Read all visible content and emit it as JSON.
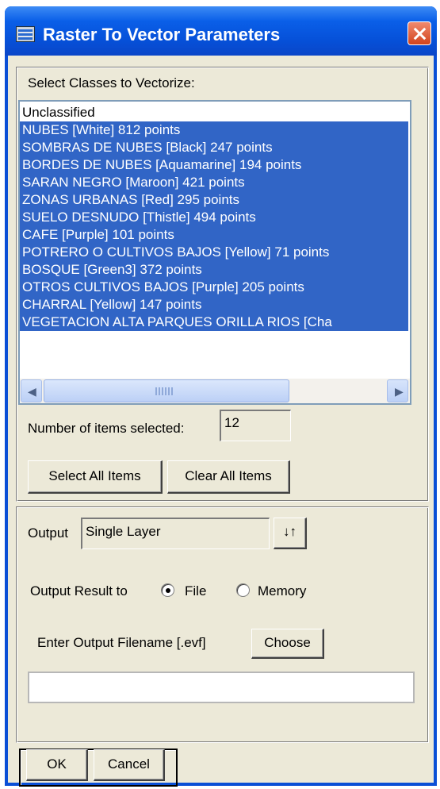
{
  "window": {
    "title": "Raster To Vector Parameters"
  },
  "classes": {
    "label": "Select Classes to Vectorize:",
    "items": [
      {
        "text": "Unclassified",
        "selected": false
      },
      {
        "text": "NUBES [White] 812 points",
        "selected": true
      },
      {
        "text": "SOMBRAS DE NUBES [Black] 247 points",
        "selected": true
      },
      {
        "text": "BORDES DE NUBES [Aquamarine] 194 points",
        "selected": true
      },
      {
        "text": "SARAN NEGRO [Maroon] 421 points",
        "selected": true
      },
      {
        "text": "ZONAS URBANAS [Red] 295 points",
        "selected": true
      },
      {
        "text": "SUELO DESNUDO [Thistle] 494 points",
        "selected": true
      },
      {
        "text": "CAFE [Purple] 101 points",
        "selected": true
      },
      {
        "text": "POTRERO O CULTIVOS BAJOS [Yellow] 71 points",
        "selected": true
      },
      {
        "text": "BOSQUE [Green3] 372 points",
        "selected": true
      },
      {
        "text": "OTROS CULTIVOS BAJOS [Purple] 205 points",
        "selected": true
      },
      {
        "text": "CHARRAL [Yellow] 147 points",
        "selected": true
      },
      {
        "text": "VEGETACION ALTA PARQUES ORILLA RIOS [Cha",
        "selected": true
      }
    ],
    "count_label": "Number of items selected:",
    "count_value": "12",
    "select_all_label": "Select All Items",
    "clear_all_label": "Clear All Items"
  },
  "output": {
    "label": "Output",
    "value": "Single Layer",
    "result_label": "Output Result to",
    "file_label": "File",
    "memory_label": "Memory",
    "selected_target": "File",
    "filename_label": "Enter Output Filename [.evf]",
    "choose_label": "Choose",
    "filename_value": ""
  },
  "footer": {
    "ok_label": "OK",
    "cancel_label": "Cancel"
  },
  "colors": {
    "title_bar": "#0a5fe8",
    "selection": "#3165c6",
    "dialog_bg": "#ece9d8",
    "close_button": "#d2431d"
  },
  "icons": {
    "app": "raster-window-icon",
    "close": "close-icon",
    "toggle": "swap-arrows-icon",
    "scroll_left": "arrow-left-icon",
    "scroll_right": "arrow-right-icon"
  }
}
